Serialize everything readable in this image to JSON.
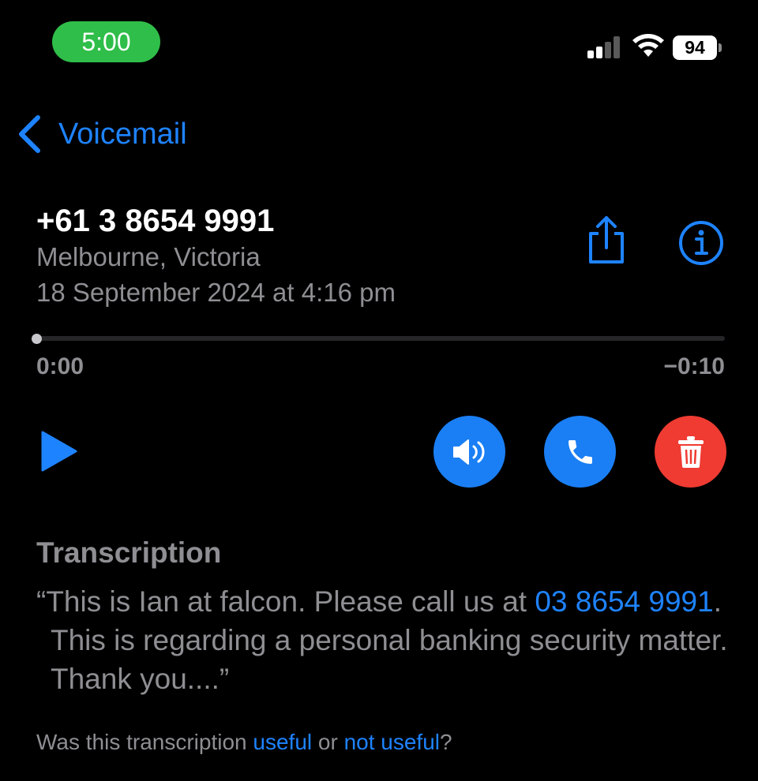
{
  "status_bar": {
    "time": "5:00",
    "battery": "94",
    "icons": [
      "cellular-signal-icon",
      "wifi-icon",
      "battery-icon"
    ]
  },
  "nav": {
    "back_label": "Voicemail",
    "back_icon": "chevron-left-icon"
  },
  "voicemail": {
    "number": "+61 3 8654 9991",
    "location": "Melbourne, Victoria",
    "date": "18 September 2024 at 4:16 pm",
    "actions": [
      "share-icon",
      "info-icon"
    ]
  },
  "playback": {
    "elapsed": "0:00",
    "remaining": "−0:10",
    "progress": 0,
    "controls": [
      "play-icon",
      "speaker-icon",
      "phone-icon",
      "trash-icon"
    ]
  },
  "transcription": {
    "heading": "Transcription",
    "part1": "“This is Ian at falcon. Please call us at ",
    "phone_link": "03 8654 9991",
    "part2": ". This is regarding a personal banking security matter. Thank you....”"
  },
  "feedback": {
    "prefix": "Was this transcription ",
    "useful": "useful",
    "or": " or ",
    "not_useful": "not useful",
    "suffix": "?"
  },
  "colors": {
    "accent": "#1e83ff",
    "button_blue": "#1a7ff5",
    "delete_red": "#ef3b32",
    "time_pill": "#2fbe49",
    "secondary_text": "#8e8e93"
  }
}
